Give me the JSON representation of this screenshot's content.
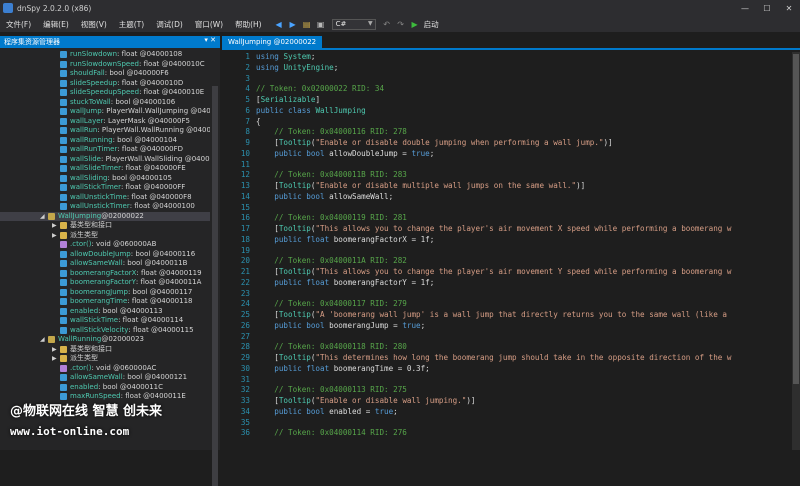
{
  "window": {
    "title": "dnSpy 2.0.2.0 (x86)",
    "minimize": "—",
    "maximize": "☐",
    "close": "✕"
  },
  "menu": [
    "文件(F)",
    "编辑(E)",
    "视图(V)",
    "主题(T)",
    "调试(D)",
    "窗口(W)",
    "帮助(H)"
  ],
  "toolbar": {
    "language": "C#",
    "start_label": "启动"
  },
  "left_panel": {
    "title": "程序集资源管理器",
    "pin": "▾ ✕"
  },
  "tree": [
    {
      "indent": 60,
      "icon": "field",
      "name": "runSlowdown",
      "rest": " : float @04000108"
    },
    {
      "indent": 60,
      "icon": "field",
      "name": "runSlowdownSpeed",
      "rest": " : float @0400010C"
    },
    {
      "indent": 60,
      "icon": "field",
      "name": "shouldFall",
      "rest": " : bool @040000F6"
    },
    {
      "indent": 60,
      "icon": "field",
      "name": "slideSpeedup",
      "rest": " : float @0400010D"
    },
    {
      "indent": 60,
      "icon": "field",
      "name": "slideSpeedupSpeed",
      "rest": " : float @0400010E"
    },
    {
      "indent": 60,
      "icon": "field",
      "name": "stuckToWall",
      "rest": " : bool @04000106"
    },
    {
      "indent": 60,
      "icon": "field",
      "name": "wallJump",
      "rest": " : PlayerWall.WallJumping @0400"
    },
    {
      "indent": 60,
      "icon": "field",
      "name": "wallLayer",
      "rest": " : LayerMask @040000F5"
    },
    {
      "indent": 60,
      "icon": "field",
      "name": "wallRun",
      "rest": " : PlayerWall.WallRunning @04000"
    },
    {
      "indent": 60,
      "icon": "field",
      "name": "wallRunning",
      "rest": " : bool @04000104"
    },
    {
      "indent": 60,
      "icon": "field",
      "name": "wallRunTimer",
      "rest": " : float @040000FD"
    },
    {
      "indent": 60,
      "icon": "field",
      "name": "wallSlide",
      "rest": " : PlayerWall.WallSliding @04000"
    },
    {
      "indent": 60,
      "icon": "field",
      "name": "wallSlideTimer",
      "rest": " : float @040000FE"
    },
    {
      "indent": 60,
      "icon": "field",
      "name": "wallSliding",
      "rest": " : bool @04000105"
    },
    {
      "indent": 60,
      "icon": "field",
      "name": "wallStickTimer",
      "rest": " : float @040000FF"
    },
    {
      "indent": 60,
      "icon": "field",
      "name": "wallUnstickTime",
      "rest": " : float @040000F8"
    },
    {
      "indent": 60,
      "icon": "field",
      "name": "wallUnstickTimer",
      "rest": " : float @04000100"
    },
    {
      "indent": 48,
      "icon": "class",
      "name": "WallJumping",
      "rest": " @02000022",
      "toggle": "◢",
      "selected": true
    },
    {
      "indent": 60,
      "icon": "folder",
      "name": "基类型和接口",
      "rest": "",
      "toggle": "▶"
    },
    {
      "indent": 60,
      "icon": "folder",
      "name": "派生类型",
      "rest": "",
      "toggle": "▶"
    },
    {
      "indent": 60,
      "icon": "method",
      "name": ".ctor()",
      "rest": " : void @060000AB"
    },
    {
      "indent": 60,
      "icon": "field",
      "name": "allowDoubleJump",
      "rest": " : bool @04000116"
    },
    {
      "indent": 60,
      "icon": "field",
      "name": "allowSameWall",
      "rest": " : bool @0400011B"
    },
    {
      "indent": 60,
      "icon": "field",
      "name": "boomerangFactorX",
      "rest": " : float @04000119"
    },
    {
      "indent": 60,
      "icon": "field",
      "name": "boomerangFactorY",
      "rest": " : float @0400011A"
    },
    {
      "indent": 60,
      "icon": "field",
      "name": "boomerangJump",
      "rest": " : bool @04000117"
    },
    {
      "indent": 60,
      "icon": "field",
      "name": "boomerangTime",
      "rest": " : float @04000118"
    },
    {
      "indent": 60,
      "icon": "field",
      "name": "enabled",
      "rest": " : bool @04000113"
    },
    {
      "indent": 60,
      "icon": "field",
      "name": "wallStickTime",
      "rest": " : float @04000114"
    },
    {
      "indent": 60,
      "icon": "field",
      "name": "wallStickVelocity",
      "rest": " : float @04000115"
    },
    {
      "indent": 48,
      "icon": "class",
      "name": "WallRunning",
      "rest": " @02000023",
      "toggle": "◢"
    },
    {
      "indent": 60,
      "icon": "folder",
      "name": "基类型和接口",
      "rest": "",
      "toggle": "▶"
    },
    {
      "indent": 60,
      "icon": "folder",
      "name": "派生类型",
      "rest": "",
      "toggle": "▶"
    },
    {
      "indent": 60,
      "icon": "method",
      "name": ".ctor()",
      "rest": " : void @060000AC"
    },
    {
      "indent": 60,
      "icon": "field",
      "name": "allowSameWall",
      "rest": " : bool @04000121"
    },
    {
      "indent": 60,
      "icon": "field",
      "name": "enabled",
      "rest": " : bool @0400011C"
    },
    {
      "indent": 60,
      "icon": "field",
      "name": "maxRunSpeed",
      "rest": " : float @0400011E"
    }
  ],
  "editor": {
    "tab_label": "WallJumping @02000022",
    "lines": [
      {
        "n": "1",
        "segs": [
          [
            "kw",
            "using "
          ],
          [
            "ty",
            "System"
          ],
          [
            "tx",
            ";"
          ]
        ]
      },
      {
        "n": "2",
        "segs": [
          [
            "kw",
            "using "
          ],
          [
            "ty",
            "UnityEngine"
          ],
          [
            "tx",
            ";"
          ]
        ]
      },
      {
        "n": "3",
        "segs": []
      },
      {
        "n": "4",
        "segs": [
          [
            "cm",
            "// Token: 0x02000022 RID: 34"
          ]
        ]
      },
      {
        "n": "5",
        "segs": [
          [
            "tx",
            "["
          ],
          [
            "ty",
            "Serializable"
          ],
          [
            "tx",
            "]"
          ]
        ]
      },
      {
        "n": "6",
        "segs": [
          [
            "kw",
            "public class "
          ],
          [
            "ty",
            "WallJumping"
          ]
        ]
      },
      {
        "n": "7",
        "segs": [
          [
            "tx",
            "{"
          ]
        ]
      },
      {
        "n": "8",
        "segs": [
          [
            "cm",
            "    // Token: 0x04000116 RID: 278"
          ]
        ]
      },
      {
        "n": "9",
        "segs": [
          [
            "tx",
            "    ["
          ],
          [
            "ty",
            "Tooltip"
          ],
          [
            "tx",
            "("
          ],
          [
            "st",
            "\"Enable or disable double jumping when performing a wall jump.\""
          ],
          [
            "tx",
            ")]"
          ]
        ]
      },
      {
        "n": "10",
        "segs": [
          [
            "kw",
            "    public bool "
          ],
          [
            "tx",
            "allowDoubleJump = "
          ],
          [
            "kw",
            "true"
          ],
          [
            "tx",
            ";"
          ]
        ]
      },
      {
        "n": "11",
        "segs": []
      },
      {
        "n": "12",
        "segs": [
          [
            "cm",
            "    // Token: 0x0400011B RID: 283"
          ]
        ]
      },
      {
        "n": "13",
        "segs": [
          [
            "tx",
            "    ["
          ],
          [
            "ty",
            "Tooltip"
          ],
          [
            "tx",
            "("
          ],
          [
            "st",
            "\"Enable or disable multiple wall jumps on the same wall.\""
          ],
          [
            "tx",
            ")]"
          ]
        ]
      },
      {
        "n": "14",
        "segs": [
          [
            "kw",
            "    public bool "
          ],
          [
            "tx",
            "allowSameWall;"
          ]
        ]
      },
      {
        "n": "15",
        "segs": []
      },
      {
        "n": "16",
        "segs": [
          [
            "cm",
            "    // Token: 0x04000119 RID: 281"
          ]
        ]
      },
      {
        "n": "17",
        "segs": [
          [
            "tx",
            "    ["
          ],
          [
            "ty",
            "Tooltip"
          ],
          [
            "tx",
            "("
          ],
          [
            "st",
            "\"This allows you to change the player's air movement X speed while performing a boomerang w"
          ]
        ]
      },
      {
        "n": "18",
        "segs": [
          [
            "kw",
            "    public float "
          ],
          [
            "tx",
            "boomerangFactorX = 1f;"
          ]
        ]
      },
      {
        "n": "19",
        "segs": []
      },
      {
        "n": "20",
        "segs": [
          [
            "cm",
            "    // Token: 0x0400011A RID: 282"
          ]
        ]
      },
      {
        "n": "21",
        "segs": [
          [
            "tx",
            "    ["
          ],
          [
            "ty",
            "Tooltip"
          ],
          [
            "tx",
            "("
          ],
          [
            "st",
            "\"This allows you to change the player's air movement Y speed while performing a boomerang w"
          ]
        ]
      },
      {
        "n": "22",
        "segs": [
          [
            "kw",
            "    public float "
          ],
          [
            "tx",
            "boomerangFactorY = 1f;"
          ]
        ]
      },
      {
        "n": "23",
        "segs": []
      },
      {
        "n": "24",
        "segs": [
          [
            "cm",
            "    // Token: 0x04000117 RID: 279"
          ]
        ]
      },
      {
        "n": "25",
        "segs": [
          [
            "tx",
            "    ["
          ],
          [
            "ty",
            "Tooltip"
          ],
          [
            "tx",
            "("
          ],
          [
            "st",
            "\"A 'boomerang wall jump' is a wall jump that directly returns you to the same wall (like a"
          ]
        ]
      },
      {
        "n": "26",
        "segs": [
          [
            "kw",
            "    public bool "
          ],
          [
            "tx",
            "boomerangJump = "
          ],
          [
            "kw",
            "true"
          ],
          [
            "tx",
            ";"
          ]
        ]
      },
      {
        "n": "27",
        "segs": []
      },
      {
        "n": "28",
        "segs": [
          [
            "cm",
            "    // Token: 0x04000118 RID: 280"
          ]
        ]
      },
      {
        "n": "29",
        "segs": [
          [
            "tx",
            "    ["
          ],
          [
            "ty",
            "Tooltip"
          ],
          [
            "tx",
            "("
          ],
          [
            "st",
            "\"This determines how long the boomerang jump should take in the opposite direction of the w"
          ]
        ]
      },
      {
        "n": "30",
        "segs": [
          [
            "kw",
            "    public float "
          ],
          [
            "tx",
            "boomerangTime = 0.3f;"
          ]
        ]
      },
      {
        "n": "31",
        "segs": []
      },
      {
        "n": "32",
        "segs": [
          [
            "cm",
            "    // Token: 0x04000113 RID: 275"
          ]
        ]
      },
      {
        "n": "33",
        "segs": [
          [
            "tx",
            "    ["
          ],
          [
            "ty",
            "Tooltip"
          ],
          [
            "tx",
            "("
          ],
          [
            "st",
            "\"Enable or disable wall jumping.\""
          ],
          [
            "tx",
            ")]"
          ]
        ]
      },
      {
        "n": "34",
        "segs": [
          [
            "kw",
            "    public bool "
          ],
          [
            "tx",
            "enabled = "
          ],
          [
            "kw",
            "true"
          ],
          [
            "tx",
            ";"
          ]
        ]
      },
      {
        "n": "35",
        "segs": []
      },
      {
        "n": "36",
        "segs": [
          [
            "cm",
            "    // Token: 0x04000114 RID: 276"
          ]
        ]
      }
    ]
  },
  "watermark": {
    "line1": "@物联网在线 智慧 创未来",
    "line2": "www.iot-online.com"
  },
  "colors": {
    "accent": "#007acc",
    "background": "#1e1e1e",
    "panel": "#252526"
  }
}
